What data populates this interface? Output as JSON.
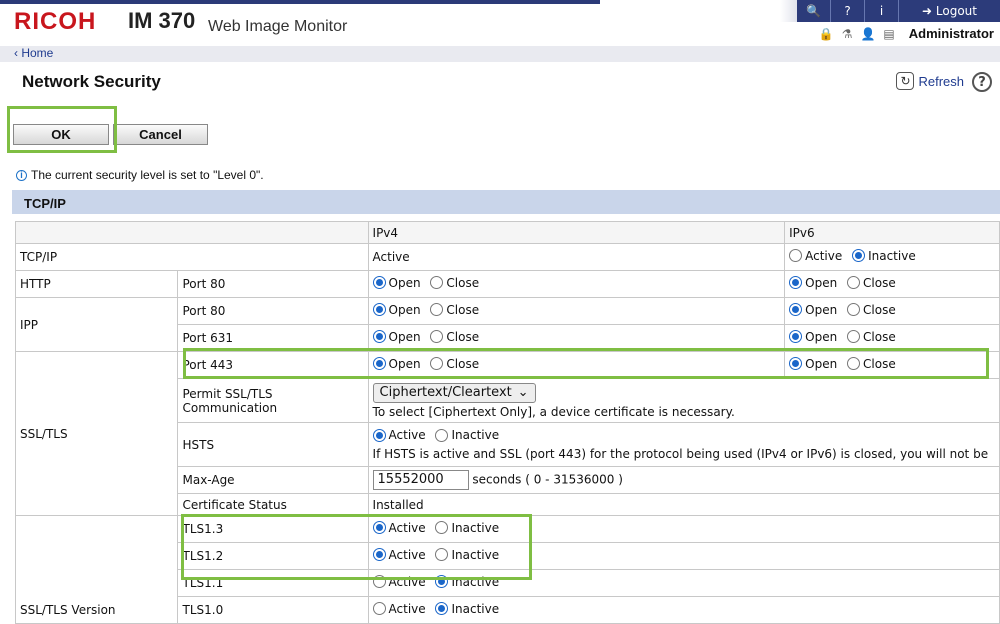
{
  "header": {
    "brand": "RICOH",
    "model": "IM 370",
    "product": "Web Image Monitor",
    "toolbar": {
      "search_icon": "search-icon",
      "help_icon": "question-icon",
      "info_icon": "info-icon",
      "logout_label": "Logout"
    },
    "user": "Administrator"
  },
  "nav": {
    "home": "Home"
  },
  "page": {
    "title": "Network Security",
    "refresh": "Refresh",
    "help": "?"
  },
  "buttons": {
    "ok": "OK",
    "cancel": "Cancel"
  },
  "info": "The current security level is set to \"Level 0\".",
  "section": "TCP/IP",
  "table": {
    "col_ipv4": "IPv4",
    "col_ipv6": "IPv6",
    "tcpip": {
      "label": "TCP/IP",
      "ipv4": "Active",
      "ipv6_active": "Active",
      "ipv6_inactive": "Inactive"
    },
    "http": {
      "label": "HTTP",
      "port": "Port 80"
    },
    "ipp": {
      "label": "IPP",
      "port1": "Port 80",
      "port2": "Port 631"
    },
    "ssl": {
      "label": "SSL/TLS",
      "port": "Port 443",
      "permit_label": "Permit SSL/TLS Communication",
      "permit_value": "Ciphertext/Cleartext",
      "permit_note": "To select [Ciphertext Only], a device certificate is necessary.",
      "hsts_label": "HSTS",
      "hsts_note": "If HSTS is active and SSL (port 443) for the protocol being used (IPv4 or IPv6) is closed, you will not be",
      "maxage_label": "Max-Age",
      "maxage_value": "15552000",
      "maxage_unit": "seconds ( 0 - 31536000 )",
      "cert_label": "Certificate Status",
      "cert_value": "Installed"
    },
    "version": {
      "label": "SSL/TLS Version",
      "tls13": "TLS1.3",
      "tls12": "TLS1.2",
      "tls11": "TLS1.1",
      "tls10": "TLS1.0"
    },
    "open": "Open",
    "close": "Close",
    "active": "Active",
    "inactive": "Inactive"
  }
}
